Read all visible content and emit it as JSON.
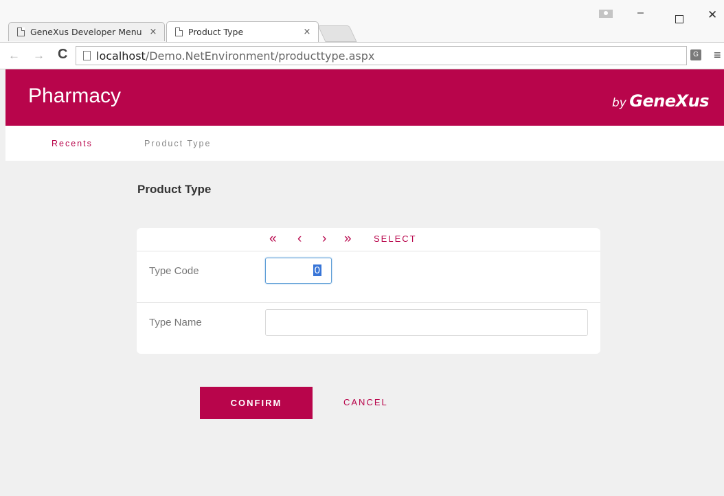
{
  "browser": {
    "tabs": [
      {
        "title": "GeneXus Developer Menu",
        "close": "×"
      },
      {
        "title": "Product Type",
        "close": "×"
      }
    ],
    "url_host": "localhost",
    "url_path": "/Demo.NetEnvironment/producttype.aspx",
    "back_glyph": "←",
    "forward_glyph": "→",
    "reload_glyph": "C",
    "menu_glyph": "≡",
    "translate_glyph": "G",
    "window_minimize": "–",
    "window_close": "✕"
  },
  "header": {
    "app_title": "Pharmacy",
    "brand_by": "by",
    "brand_name": "GeneXus",
    "accent_color": "#b8054b"
  },
  "nav": {
    "recents": "Recents",
    "product_type": "Product Type"
  },
  "page": {
    "title": "Product Type"
  },
  "record_nav": {
    "first": "«",
    "previous": "‹",
    "next": "›",
    "last": "»",
    "select": "SELECT"
  },
  "form": {
    "type_code_label": "Type Code",
    "type_code_value": "0",
    "type_name_label": "Type Name",
    "type_name_value": ""
  },
  "actions": {
    "confirm": "CONFIRM",
    "cancel": "CANCEL"
  }
}
